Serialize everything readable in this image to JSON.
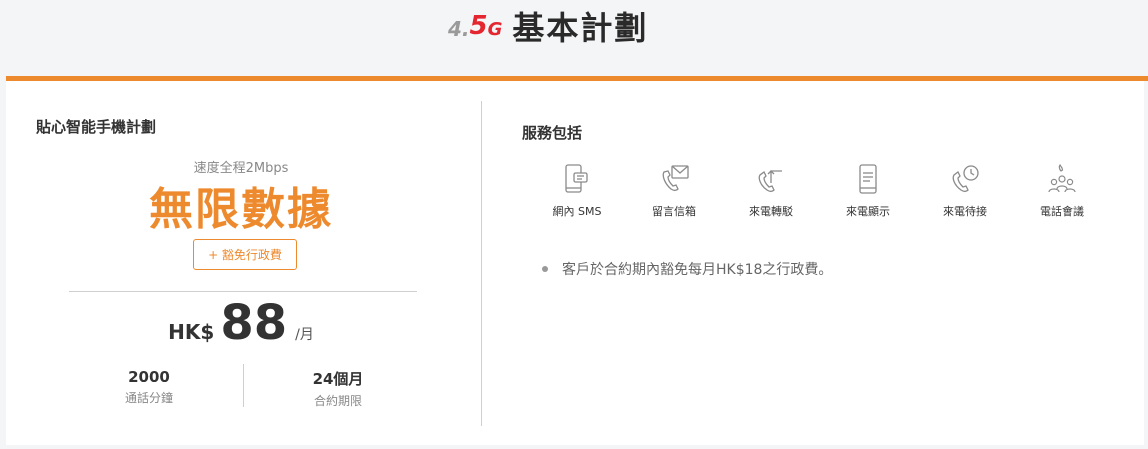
{
  "header": {
    "logo": {
      "four": "4.",
      "five": "5",
      "g": "G"
    },
    "title": "基本計劃"
  },
  "colors": {
    "accent": "#ee8a2e",
    "logo_red": "#e3262f",
    "icon_gray": "#8a8a8a"
  },
  "plan": {
    "name": "貼心智能手機計劃",
    "speed_note": "速度全程2Mbps",
    "data_label": "無限數據",
    "waive_button": "+ 豁免行政費",
    "price": {
      "currency": "HK$",
      "amount": "88",
      "period": "/月"
    },
    "stats": [
      {
        "value": "2000",
        "label": "通話分鐘"
      },
      {
        "value": "24個月",
        "label": "合約期限"
      }
    ]
  },
  "services": {
    "heading": "服務包括",
    "items": [
      {
        "icon": "sms-phone-icon",
        "label": "網內 SMS"
      },
      {
        "icon": "voicemail-icon",
        "label": "留言信箱"
      },
      {
        "icon": "call-forward-icon",
        "label": "來電轉駁"
      },
      {
        "icon": "caller-id-icon",
        "label": "來電顯示"
      },
      {
        "icon": "call-waiting-icon",
        "label": "來電待接"
      },
      {
        "icon": "conference-call-icon",
        "label": "電話會議"
      }
    ]
  },
  "notes": [
    "客戶於合約期內豁免每月HK$18之行政費。"
  ]
}
